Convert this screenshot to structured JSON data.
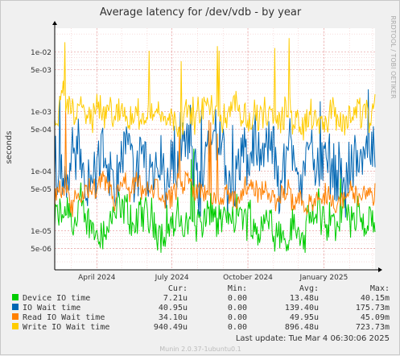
{
  "chart_data": {
    "type": "line",
    "title": "Average latency for /dev/vdb - by year",
    "ylabel": "seconds",
    "side_label": "RRDTOOL / TOBI OETIKER",
    "y_scale": "log",
    "ylim": [
      2.2e-06,
      0.025
    ],
    "y_ticks": [
      {
        "value": 0.01,
        "label": "1e-02"
      },
      {
        "value": 0.005,
        "label": "5e-03"
      },
      {
        "value": 0.001,
        "label": "1e-03"
      },
      {
        "value": 0.0005,
        "label": "5e-04"
      },
      {
        "value": 0.0001,
        "label": "1e-04"
      },
      {
        "value": 5e-05,
        "label": "5e-05"
      },
      {
        "value": 1e-05,
        "label": "1e-05"
      },
      {
        "value": 5e-06,
        "label": "5e-06"
      }
    ],
    "xlim": [
      "2024-02-10",
      "2025-03-04"
    ],
    "x_ticks": [
      {
        "date": "2024-04-01",
        "label": "April 2024"
      },
      {
        "date": "2024-07-01",
        "label": "July 2024"
      },
      {
        "date": "2024-10-01",
        "label": "October 2024"
      },
      {
        "date": "2025-01-01",
        "label": "January 2025"
      }
    ],
    "grid": true,
    "series": [
      {
        "name": "Device IO time",
        "color": "#00cc00",
        "typical": 1.35e-05,
        "spread": 0.55,
        "cur": "7.21u",
        "min": "0.00",
        "avg": "13.48u",
        "max": "40.15m"
      },
      {
        "name": "IO Wait time",
        "color": "#0066b3",
        "typical": 0.000139,
        "spread": 0.85,
        "cur": "40.95u",
        "min": "0.00",
        "avg": "139.40u",
        "max": "175.73m"
      },
      {
        "name": "Read IO Wait time",
        "color": "#ff8000",
        "typical": 4e-05,
        "spread": 0.35,
        "cur": "34.10u",
        "min": "0.00",
        "avg": "49.95u",
        "max": "45.09m"
      },
      {
        "name": "Write IO Wait time",
        "color": "#ffcc00",
        "typical": 0.0009,
        "spread": 0.45,
        "cur": "940.49u",
        "min": "0.00",
        "avg": "896.48u",
        "max": "723.73m"
      }
    ]
  },
  "legend_headers": {
    "cur": "Cur:",
    "min": "Min:",
    "avg": "Avg:",
    "max": "Max:"
  },
  "last_update": "Last update: Tue Mar  4 06:30:06 2025",
  "footer": "Munin 2.0.37-1ubuntu0.1"
}
